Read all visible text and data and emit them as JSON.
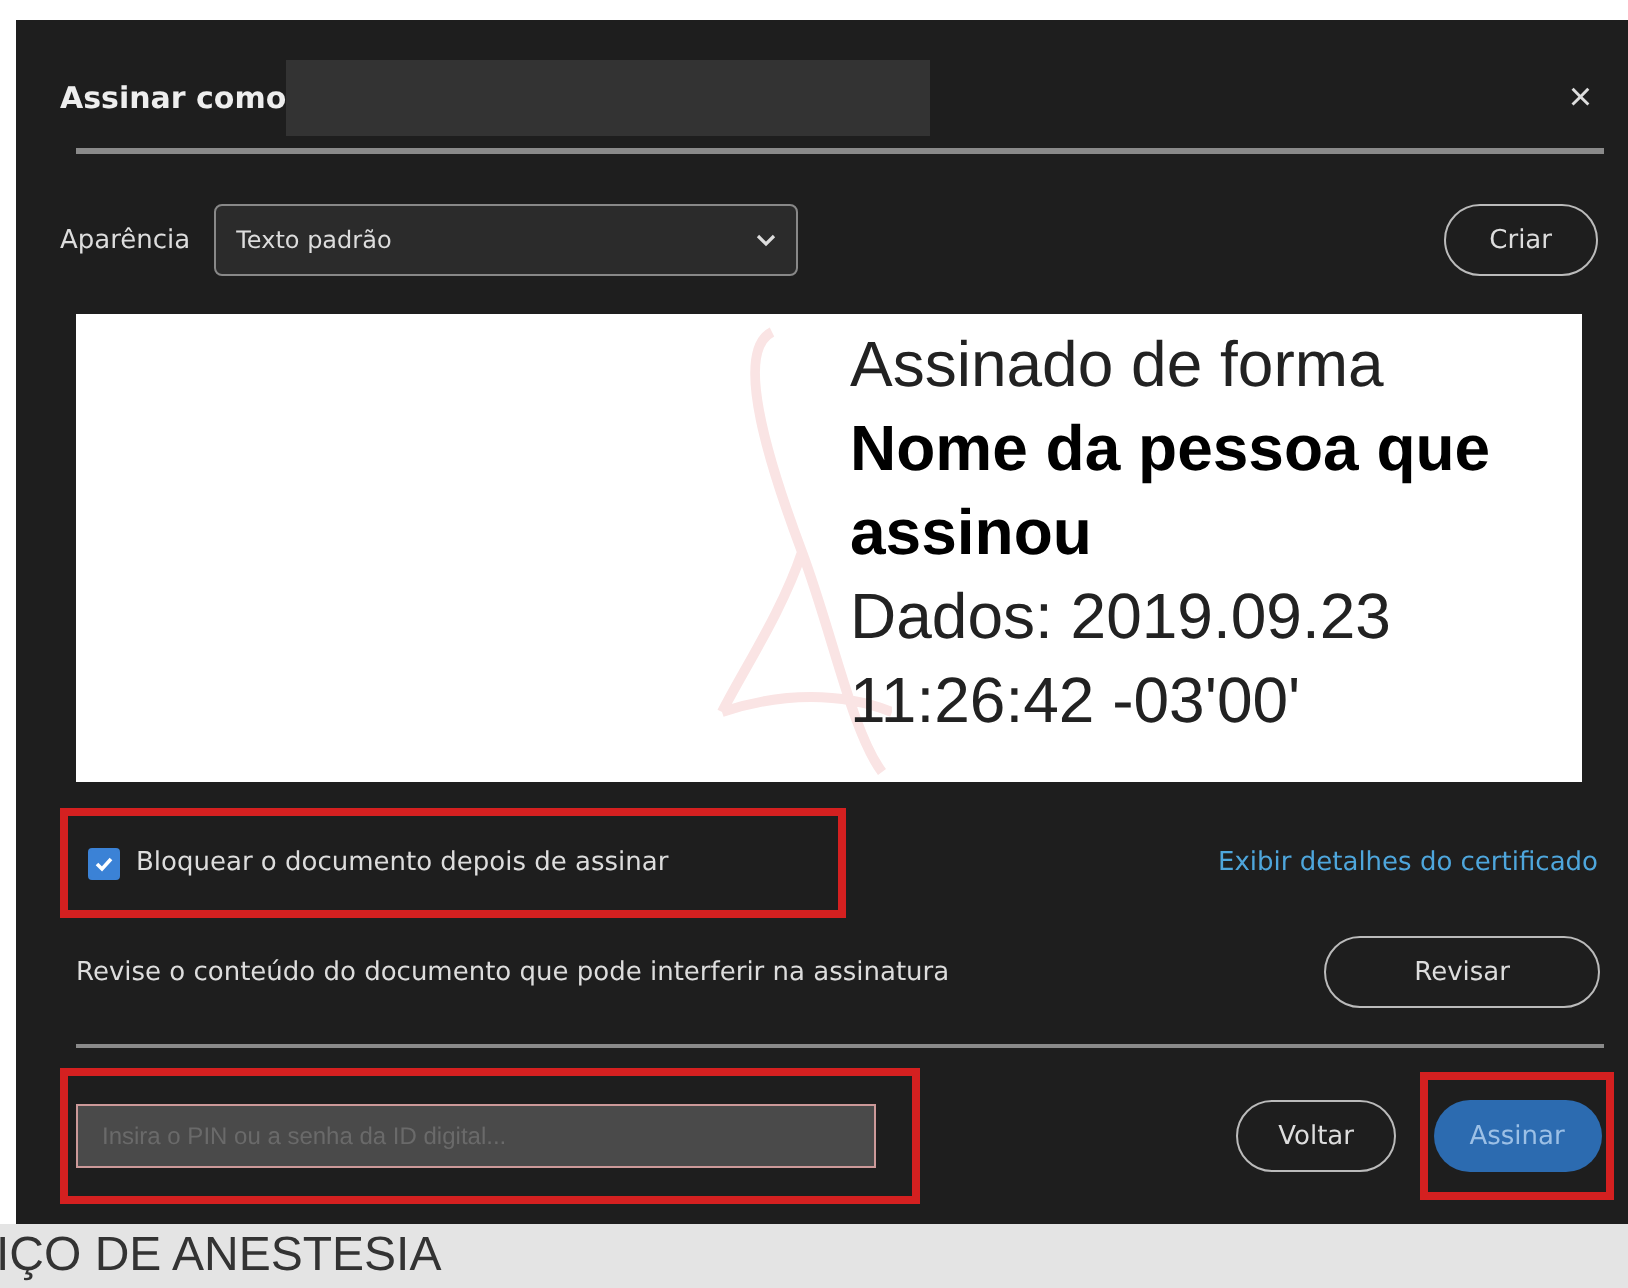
{
  "dialog": {
    "title": "Assinar como",
    "close": "×"
  },
  "appearance": {
    "label": "Aparência",
    "value": "Texto padrão",
    "create_button": "Criar"
  },
  "preview": {
    "lines": [
      {
        "text": "Assinado de forma",
        "bold": false
      },
      {
        "text": "Nome da pessoa que",
        "bold": true
      },
      {
        "text": "assinou",
        "bold": true
      },
      {
        "text": "Dados: 2019.09.23",
        "bold": false
      },
      {
        "text": "11:26:42 -03'00'",
        "bold": false
      }
    ]
  },
  "lock": {
    "label": "Bloquear o documento depois de assinar",
    "checked": true
  },
  "certificate_link": "Exibir detalhes do certificado",
  "review": {
    "text": "Revise o conteúdo do documento que pode interferir na assinatura",
    "button": "Revisar"
  },
  "pin": {
    "placeholder": "Insira o PIN ou a senha da ID digital..."
  },
  "buttons": {
    "back": "Voltar",
    "sign": "Assinar"
  },
  "background_text": "IÇO DE ANESTESIA"
}
